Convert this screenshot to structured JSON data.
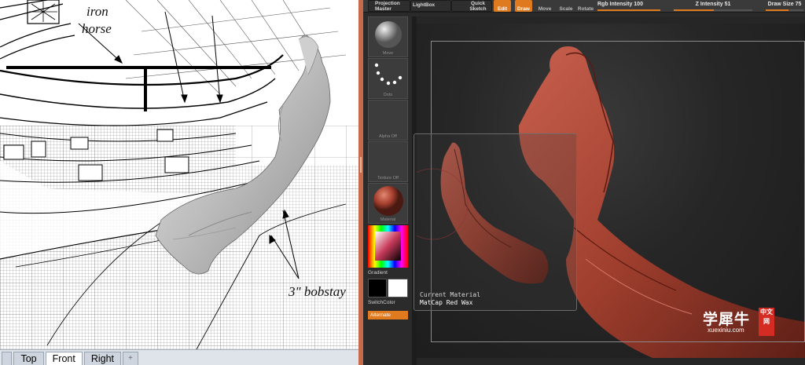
{
  "left_viewport": {
    "annotations": {
      "iron_horse_line1": "iron",
      "iron_horse_line2": "horse",
      "bobstay": "3\" bobstay"
    },
    "tabs": [
      {
        "label": "Top",
        "active": false
      },
      {
        "label": "Front",
        "active": true
      },
      {
        "label": "Right",
        "active": false
      },
      {
        "label": "+",
        "active": false
      }
    ]
  },
  "zbrush": {
    "topbar": {
      "projection_master": "Projection Master",
      "lightbox": "LightBox",
      "quick_sketch": "Quick Sketch",
      "edit": "Edit",
      "draw": "Draw",
      "move": "Move",
      "scale": "Scale",
      "rotate": "Rotate",
      "rgb_intensity": "Rgb Intensity 100",
      "z_intensity": "Z Intensity 51",
      "draw_size": "Draw Size 75",
      "accent_color": "#e07a1e"
    },
    "shelf": {
      "tiles": [
        {
          "caption": "Move"
        },
        {
          "caption": "Dots"
        },
        {
          "caption": "Alpha Off"
        },
        {
          "caption": "Texture Off"
        },
        {
          "caption": "Material"
        }
      ],
      "gradient_label": "Gradient",
      "switch_color_label": "SwitchColor",
      "alternate_button": "Alternate"
    },
    "material_popup": {
      "current_label": "Current Material",
      "material_name": "MatCap Red Wax",
      "material_color": "#b04a3c"
    }
  },
  "watermark": {
    "chinese": "学犀牛",
    "badge": "中文网",
    "url": "xuexiniu.com"
  }
}
